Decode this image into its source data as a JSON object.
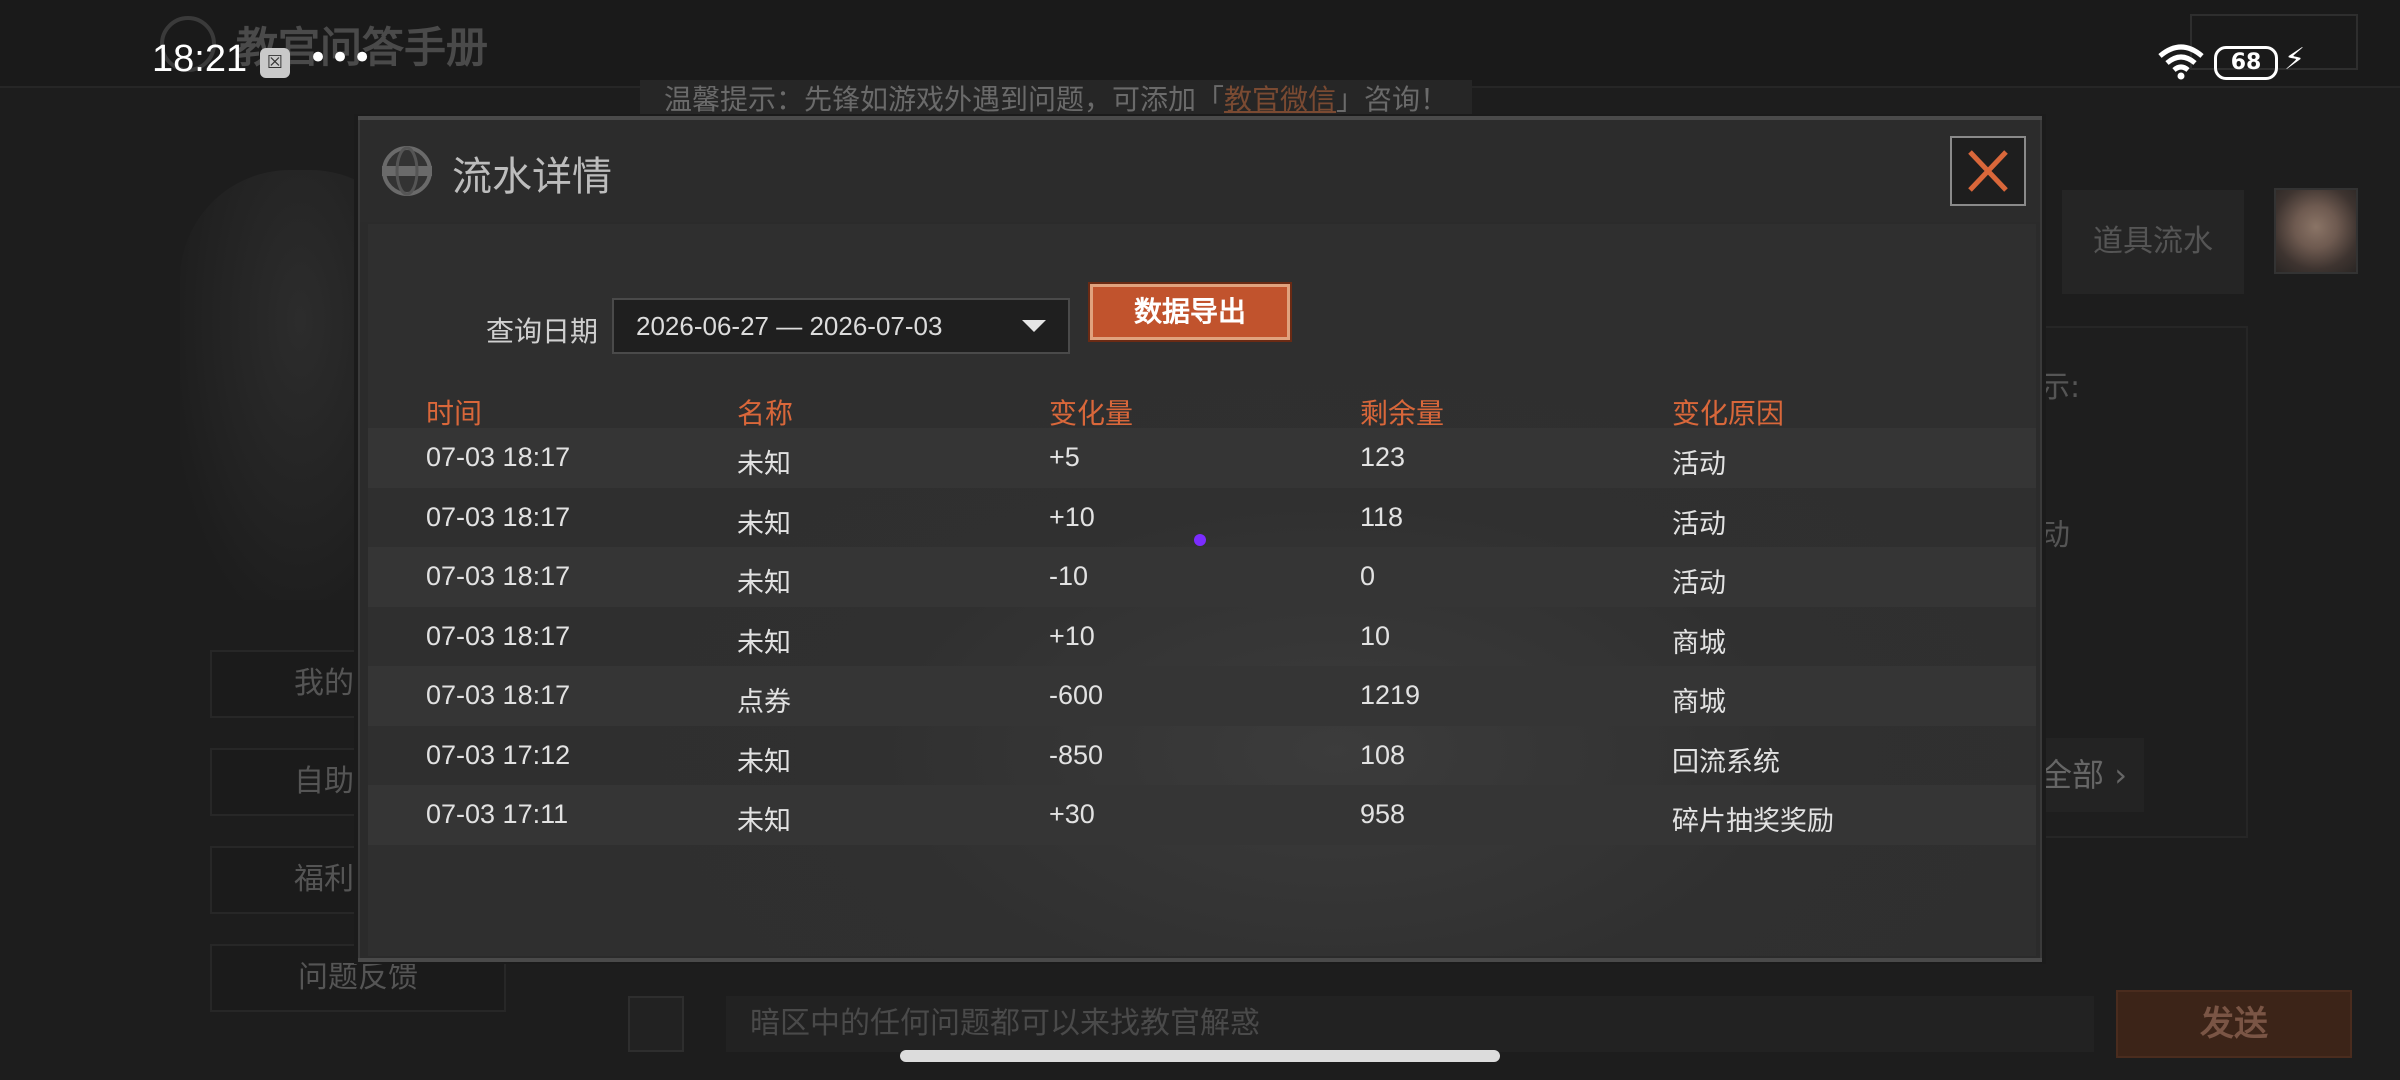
{
  "status_bar": {
    "time": "18:21",
    "more": "•••",
    "battery": "68"
  },
  "background": {
    "app_title": "教官问答手册",
    "notice_prefix": "温馨提示：先锋如游戏外遇到问题，可添加「",
    "notice_link": "教官微信",
    "notice_suffix": "」咨询！",
    "menu": [
      "我的",
      "自助",
      "福利",
      "问题反馈"
    ],
    "right_tab": "道具流水",
    "right_text1": "示:",
    "right_text2": "动",
    "right_button": "全部",
    "input_placeholder": "暗区中的任何问题都可以来找教官解惑",
    "send_label": "发送"
  },
  "modal": {
    "title": "流水详情",
    "query_label": "查询日期",
    "date_range": "2026-06-27 — 2026-07-03",
    "export_label": "数据导出",
    "columns": [
      "时间",
      "名称",
      "变化量",
      "剩余量",
      "变化原因"
    ],
    "rows": [
      [
        "07-03 18:17",
        "未知",
        "+5",
        "123",
        "活动"
      ],
      [
        "07-03 18:17",
        "未知",
        "+10",
        "118",
        "活动"
      ],
      [
        "07-03 18:17",
        "未知",
        "-10",
        "0",
        "活动"
      ],
      [
        "07-03 18:17",
        "未知",
        "+10",
        "10",
        "商城"
      ],
      [
        "07-03 18:17",
        "点券",
        "-600",
        "1219",
        "商城"
      ],
      [
        "07-03 17:12",
        "未知",
        "-850",
        "108",
        "回流系统"
      ],
      [
        "07-03 17:11",
        "未知",
        "+30",
        "958",
        "碎片抽奖奖励"
      ]
    ]
  },
  "colors": {
    "accent": "#d9673a",
    "export_button": "#c1532d",
    "modal_bg": "#2b2b2b"
  }
}
